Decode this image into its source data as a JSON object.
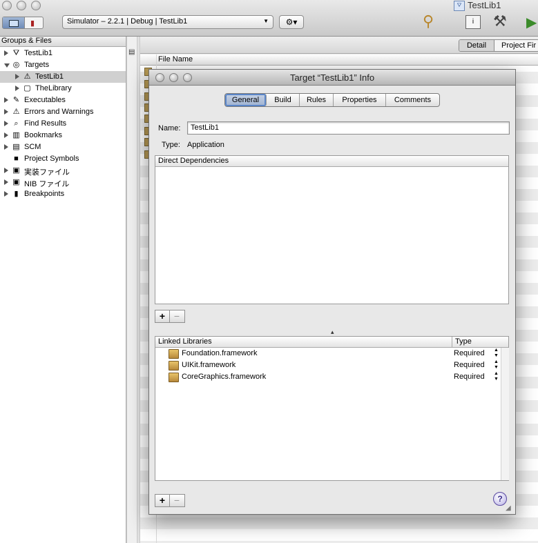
{
  "window": {
    "title": "TestLib1"
  },
  "toolbar": {
    "scheme": "Simulator – 2.2.1 | Debug | TestLib1",
    "action_glyph": "⚙▾",
    "icons": [
      "clean-broom-icon",
      "info-icon",
      "build-hammer-icon",
      "build-and-go-icon"
    ]
  },
  "sidebar": {
    "header": "Groups & Files",
    "items": [
      {
        "label": "TestLib1",
        "icon": "project-icon",
        "glyph": "⛛",
        "level": 0,
        "expanded": false
      },
      {
        "label": "Targets",
        "icon": "target-icon",
        "glyph": "◎",
        "level": 0,
        "expanded": true
      },
      {
        "label": "TestLib1",
        "icon": "app-target-icon",
        "glyph": "⚠",
        "level": 1,
        "expanded": false,
        "selected": true
      },
      {
        "label": "TheLibrary",
        "icon": "library-box-icon",
        "glyph": "▢",
        "level": 1,
        "expanded": false
      },
      {
        "label": "Executables",
        "icon": "executables-icon",
        "glyph": "✎",
        "level": 0,
        "expanded": false
      },
      {
        "label": "Errors and Warnings",
        "icon": "warning-icon",
        "glyph": "⚠",
        "level": 0,
        "expanded": false
      },
      {
        "label": "Find Results",
        "icon": "magnifier-icon",
        "glyph": "⌕",
        "level": 0,
        "expanded": false
      },
      {
        "label": "Bookmarks",
        "icon": "bookmarks-icon",
        "glyph": "▥",
        "level": 0,
        "expanded": false
      },
      {
        "label": "SCM",
        "icon": "scm-icon",
        "glyph": "▤",
        "level": 0,
        "expanded": false
      },
      {
        "label": "Project Symbols",
        "icon": "symbols-cube-icon",
        "glyph": "■",
        "level": 0,
        "expanded": false,
        "no_triangle": true
      },
      {
        "label": "実装ファイル",
        "icon": "smart-group-icon",
        "glyph": "▣",
        "level": 0,
        "expanded": false
      },
      {
        "label": "NIB ファイル",
        "icon": "smart-group-icon",
        "glyph": "▣",
        "level": 0,
        "expanded": false
      },
      {
        "label": "Breakpoints",
        "icon": "breakpoints-icon",
        "glyph": "▮",
        "level": 0,
        "expanded": false
      }
    ]
  },
  "detail": {
    "detail_tab": "Detail",
    "project_find_tab": "Project Fir",
    "column_header": "File Name"
  },
  "panel": {
    "title": "Target “TestLib1” Info",
    "tabs": [
      "General",
      "Build",
      "Rules",
      "Properties",
      "Comments"
    ],
    "active_tab": "General",
    "name_label": "Name:",
    "name_value": "TestLib1",
    "type_label": "Type:",
    "type_value": "Application",
    "deps_header": "Direct Dependencies",
    "libs_header_name": "Linked Libraries",
    "libs_header_type": "Type",
    "libraries": [
      {
        "name": "Foundation.framework",
        "type": "Required"
      },
      {
        "name": "UIKit.framework",
        "type": "Required"
      },
      {
        "name": "CoreGraphics.framework",
        "type": "Required"
      }
    ],
    "plus": "+",
    "minus": "−",
    "help": "?"
  },
  "colors": {
    "selection": "#d0d0d0",
    "tab_active": "#9fb2d0",
    "accent": "#5b86c8"
  }
}
